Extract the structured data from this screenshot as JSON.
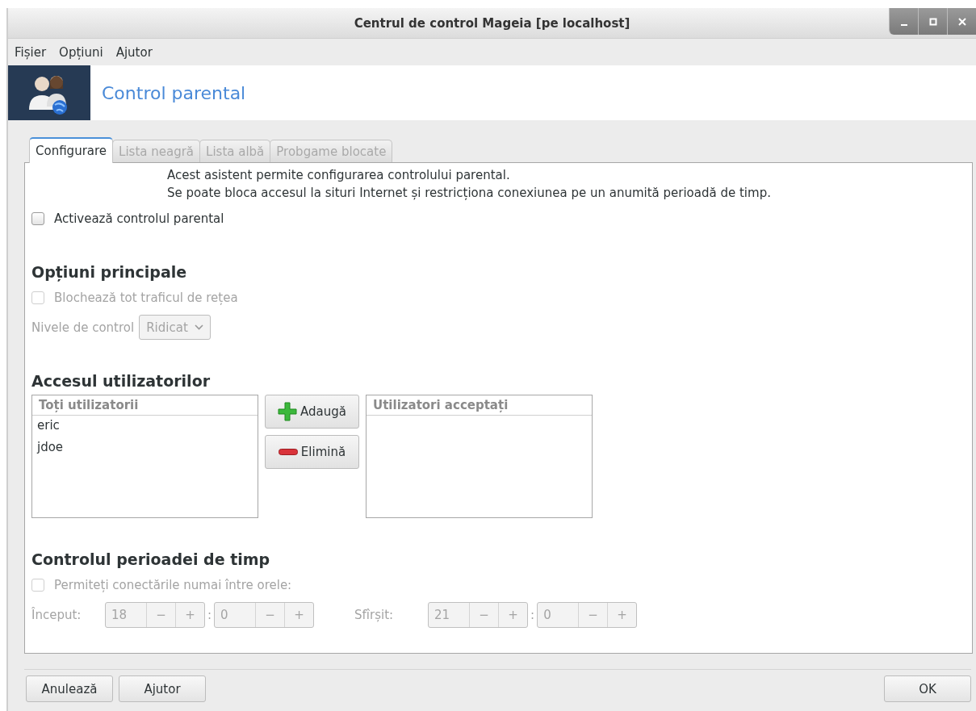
{
  "window": {
    "title": "Centrul de control Mageia  [pe localhost]"
  },
  "menu": [
    "Fișier",
    "Opțiuni",
    "Ajutor"
  ],
  "header": {
    "title": "Control parental"
  },
  "tabs": [
    {
      "label": "Configurare",
      "selected": true,
      "disabled": false
    },
    {
      "label": "Lista neagră",
      "selected": false,
      "disabled": true
    },
    {
      "label": "Lista albă",
      "selected": false,
      "disabled": true
    },
    {
      "label": "Probgame blocate",
      "selected": false,
      "disabled": true
    }
  ],
  "intro": [
    "Acest asistent permite configurarea controlului parental.",
    "Se poate bloca accesul la situri Internet și restricționa conexiunea pe un anumită perioadă de timp."
  ],
  "enable": {
    "label": "Activează controlul parental",
    "checked": false,
    "disabled": false
  },
  "main_options": {
    "heading": "Opțiuni principale",
    "block_all": {
      "label": "Blochează tot traficul de rețea",
      "checked": false,
      "disabled": true
    },
    "level_label": "Nivele de control",
    "level_value": "Ridicat",
    "disabled": true
  },
  "user_access": {
    "heading": "Accesul utilizatorilor",
    "all_users": {
      "header": "Toți utilizatorii",
      "rows": [
        "eric",
        "jdoe"
      ]
    },
    "buttons": [
      {
        "label": "Adaugă",
        "kind": "add"
      },
      {
        "label": "Elimină",
        "kind": "remove"
      }
    ],
    "accepted_users": {
      "header": "Utilizatori acceptați"
    }
  },
  "time_control": {
    "heading": "Controlul perioadei de timp",
    "allow": {
      "label": "Permiteți conectările numai între orele:",
      "checked": false,
      "disabled": true
    },
    "ranges": [
      {
        "label": "Început:",
        "hour": {
          "value": "18",
          "minus": "−",
          "plus": "+"
        },
        "separator": ":",
        "minute": {
          "value": "0",
          "minus": "−",
          "plus": "+"
        }
      },
      {
        "label": "Sfîrșit:",
        "hour": {
          "value": "21",
          "minus": "−",
          "plus": "+"
        },
        "separator": ":",
        "minute": {
          "value": "0",
          "minus": "−",
          "plus": "+"
        }
      }
    ],
    "disabled": true
  },
  "footer": {
    "left": [
      "Anulează",
      "Ajutor"
    ],
    "right": [
      "OK"
    ]
  }
}
